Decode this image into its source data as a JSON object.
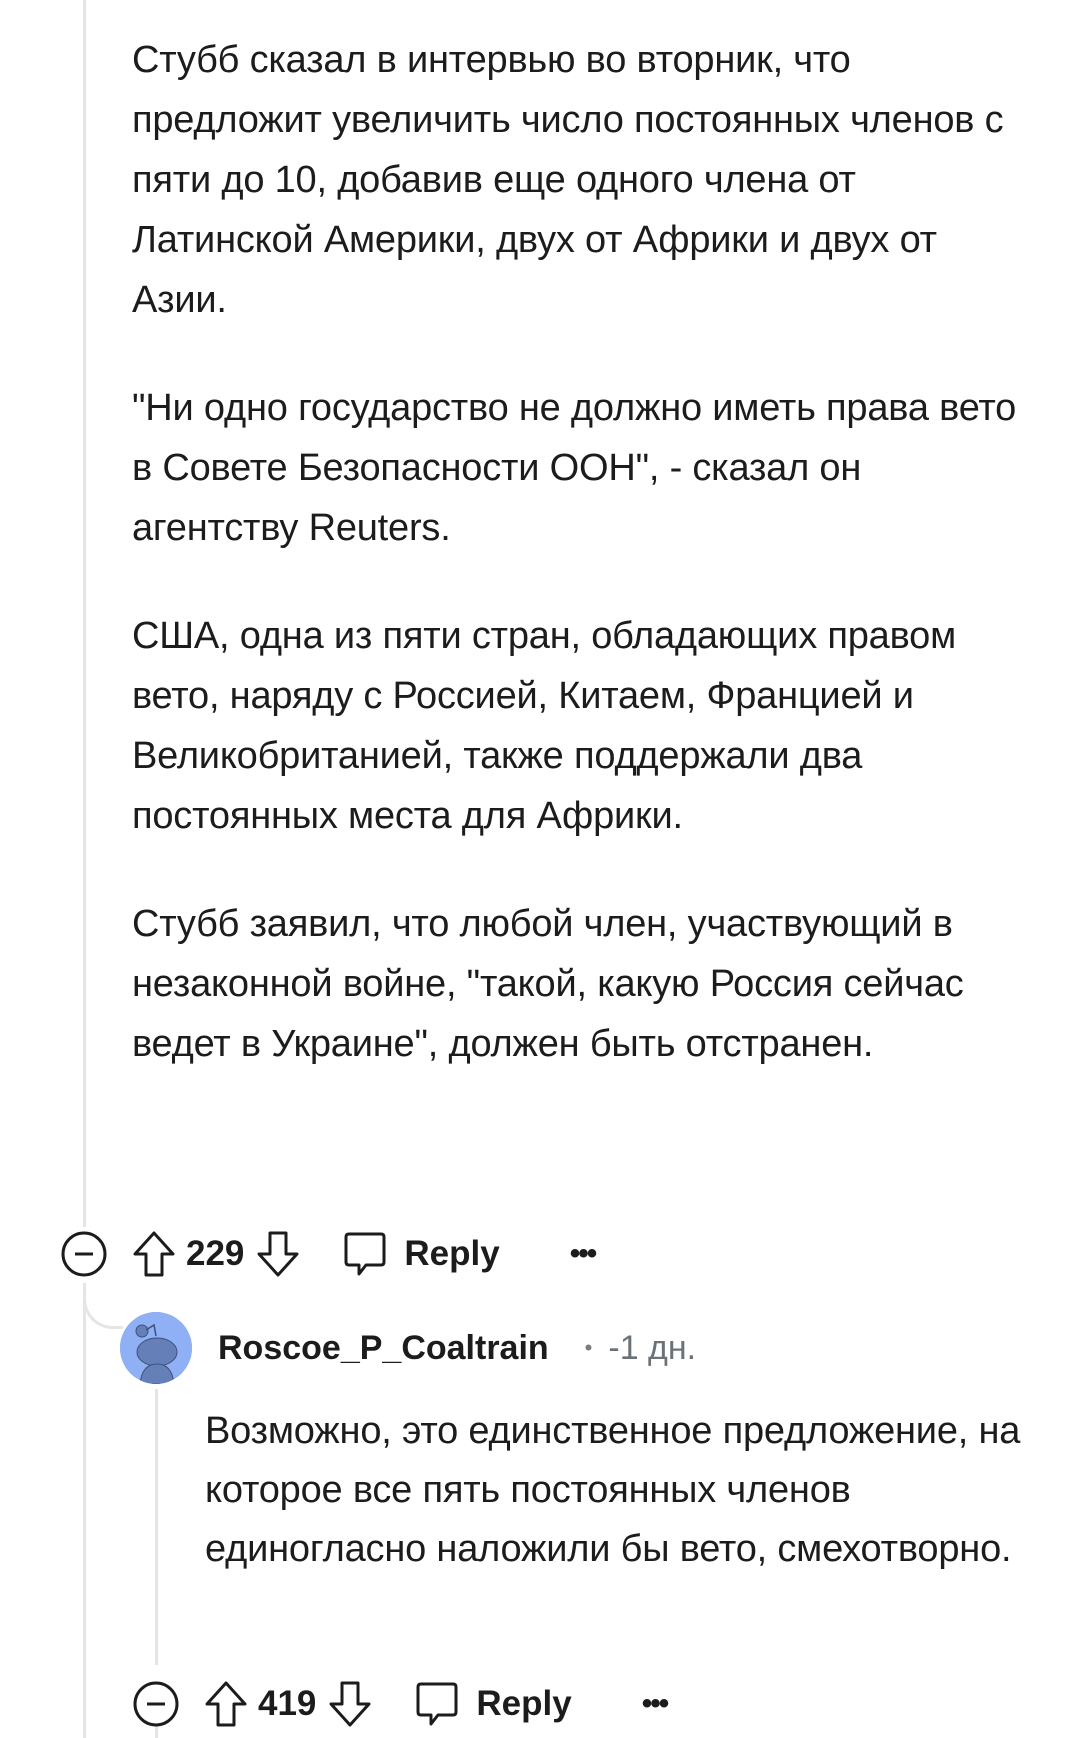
{
  "comment": {
    "paragraphs": [
      "Стубб сказал в интервью во вторник, что предложит увеличить число постоянных членов с пяти до 10, добавив еще одного члена от Латинской Америки, двух от Африки и двух от Азии.",
      "\"Ни одно государство не должно иметь права вето в Совете Безопасности ООН\", - сказал он агентству Reuters.",
      "США, одна из пяти стран, обладающих правом вето, наряду с Россией, Китаем, Францией и Великобританией, также поддержали два постоянных места для Африки.",
      "Стубб заявил, что любой член, участвующий в незаконной войне, \"такой, какую Россия сейчас ведет в Украине\", должен быть отстранен."
    ],
    "actions": {
      "collapse_icon": "minus-circle-icon",
      "upvote_icon": "arrow-up-icon",
      "score": "229",
      "downvote_icon": "arrow-down-icon",
      "reply_icon": "speech-bubble-icon",
      "reply_label": "Reply",
      "more_label": "•••"
    }
  },
  "reply": {
    "username": "Roscoe_P_Coaltrain",
    "separator": "•",
    "timestamp": "-1 дн.",
    "avatar_color": "#8fb0f5",
    "paragraphs": [
      "Возможно, это единственное предложение, на которое все пять постоянных членов единогласно наложили бы вето, смехотворно."
    ],
    "actions": {
      "score": "419",
      "reply_label": "Reply",
      "more_label": "•••"
    }
  }
}
